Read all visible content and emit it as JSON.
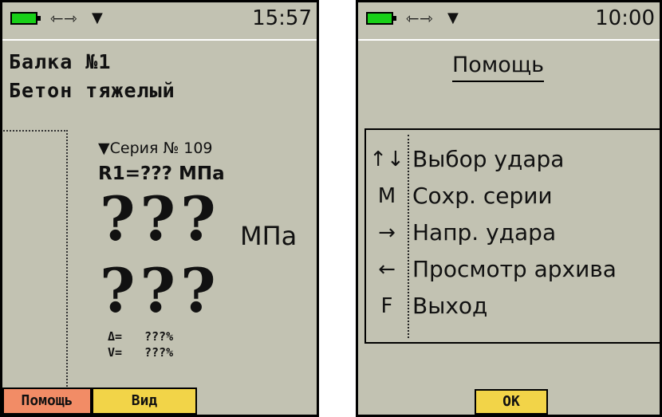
{
  "left_screen": {
    "status": {
      "time": "15:57",
      "usb_glyph": "⇽⇾",
      "signal_glyph": "▼"
    },
    "title_line1": "Балка №1",
    "title_line2": "Бетон тяжелый",
    "series_label": "▼Серия № 109",
    "r1_readout": "R1=??? МПа",
    "main_value_top": "???",
    "main_value_bottom": "???",
    "unit": "МПа",
    "delta_label": "Δ=",
    "delta_value": "???%",
    "v_label": "V=",
    "v_value": "???%",
    "softkeys": {
      "help": "Помощь",
      "view": "Вид"
    }
  },
  "right_screen": {
    "status": {
      "time": "10:00",
      "usb_glyph": "⇽⇾",
      "signal_glyph": "▼"
    },
    "title": "Помощь",
    "items": [
      {
        "key": "↑↓",
        "label": "Выбор удара"
      },
      {
        "key": "M",
        "label": "Сохр. серии"
      },
      {
        "key": "→",
        "label": "Напр. удара"
      },
      {
        "key": "←",
        "label": "Просмотр архива"
      },
      {
        "key": "F",
        "label": "Выход"
      }
    ],
    "ok_label": "OK"
  },
  "colors": {
    "screen_bg": "#c2c2b2",
    "battery": "#18d018",
    "softkey_help": "#f28c66",
    "softkey_yellow": "#f2d448"
  },
  "icons": {
    "battery": "battery-icon",
    "usb": "usb-icon",
    "signal": "signal-icon"
  }
}
